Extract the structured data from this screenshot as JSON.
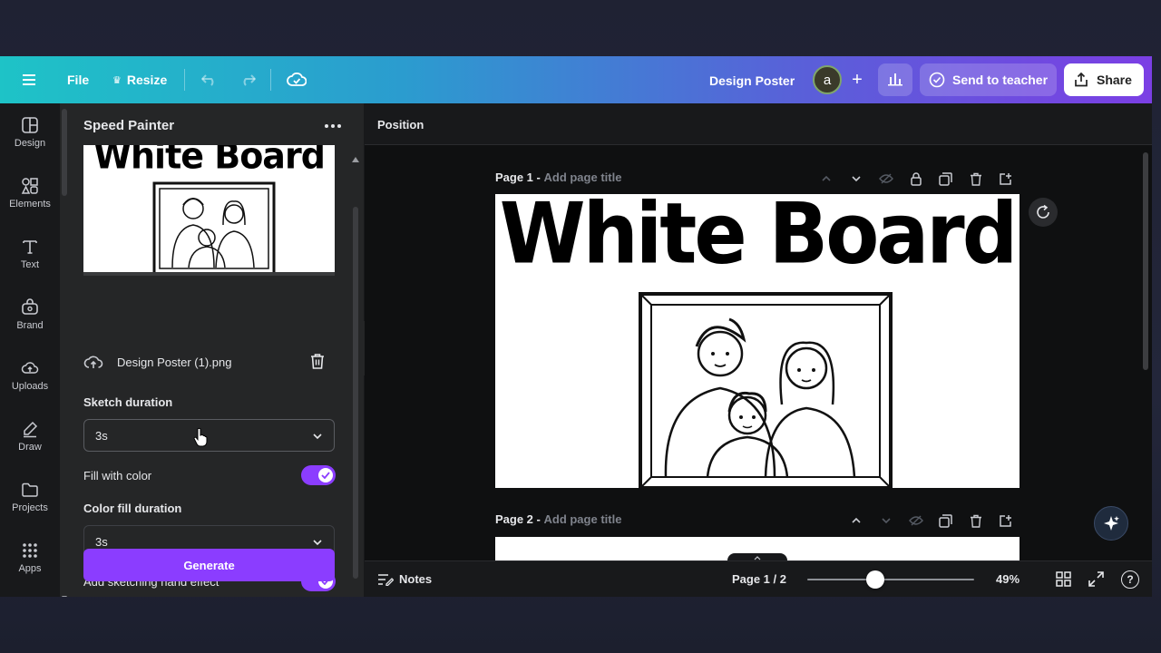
{
  "topbar": {
    "file_label": "File",
    "resize_label": "Resize",
    "design_title": "Design Poster",
    "avatar_initial": "a",
    "send_label": "Send to teacher",
    "share_label": "Share"
  },
  "rail": {
    "items": [
      {
        "label": "Design",
        "icon": "layout-icon"
      },
      {
        "label": "Elements",
        "icon": "shapes-icon"
      },
      {
        "label": "Text",
        "icon": "text-icon"
      },
      {
        "label": "Brand",
        "icon": "brand-icon"
      },
      {
        "label": "Uploads",
        "icon": "cloud-upload-icon"
      },
      {
        "label": "Draw",
        "icon": "pen-icon"
      },
      {
        "label": "Projects",
        "icon": "folder-icon"
      },
      {
        "label": "Apps",
        "icon": "grid-icon"
      }
    ]
  },
  "panel": {
    "title": "Speed Painter",
    "preview_title": "White Board",
    "file_name": "Design Poster (1).png",
    "sketch_label": "Sketch duration",
    "sketch_value": "3s",
    "fill_label": "Fill with color",
    "fill_on": true,
    "color_fill_label": "Color fill duration",
    "color_fill_value": "3s",
    "hand_label": "Add sketching hand effect",
    "hand_on": true,
    "generate_label": "Generate"
  },
  "canvas": {
    "position_label": "Position",
    "page1_label": "Page 1 -",
    "page1_placeholder": "Add page title",
    "page2_label": "Page 2 -",
    "page2_placeholder": "Add page title",
    "board_title": "White Board"
  },
  "footer": {
    "notes_label": "Notes",
    "page_indicator": "Page 1 / 2",
    "zoom_percent": 49,
    "zoom_label": "49%"
  },
  "colors": {
    "accent": "#8b3dff",
    "topbar_start": "#1ec3c7",
    "topbar_end": "#7b3fe4"
  }
}
